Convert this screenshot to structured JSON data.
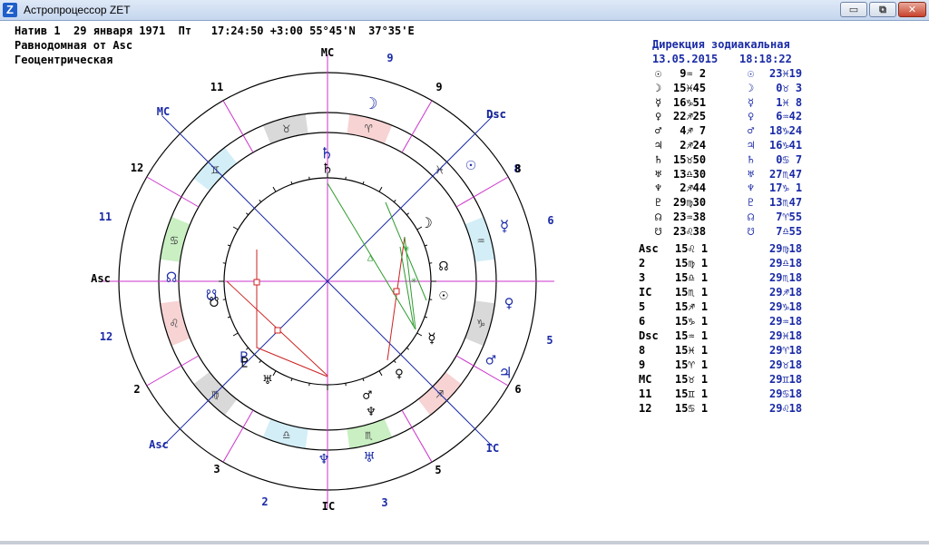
{
  "window": {
    "title": "Астропроцессор ZET",
    "app_icon": "Z",
    "minimize": "▭",
    "maximize": "⧉",
    "close": "✕"
  },
  "header": {
    "line1": "Натив 1  29 января 1971  Пт   17:24:50 +3:00 55°45'N  37°35'E",
    "line2": "Равнодомная от Asc",
    "line3": "Геоцентрическая"
  },
  "chart": {
    "outer_houses": [
      {
        "label": "MC",
        "color": "#000000"
      },
      {
        "label": "9",
        "color": "#1a2aa6"
      },
      {
        "label": "8",
        "color": "#1a2aa6"
      },
      {
        "label": "Dsc",
        "color": "#000000"
      },
      {
        "label": "6",
        "color": "#1a2aa6"
      },
      {
        "label": "5",
        "color": "#1a2aa6"
      },
      {
        "label": "IC",
        "color": "#000000"
      },
      {
        "label": "3",
        "color": "#1a2aa6"
      },
      {
        "label": "2",
        "color": "#1a2aa6"
      },
      {
        "label": "Asc",
        "color": "#000000"
      },
      {
        "label": "12",
        "color": "#1a2aa6"
      },
      {
        "label": "11",
        "color": "#1a2aa6"
      },
      {
        "label": "MC",
        "color": "#1a2aa6"
      },
      {
        "label": "Dsc",
        "color": "#1a2aa6"
      },
      {
        "label": "IC",
        "color": "#1a2aa6"
      },
      {
        "label": "Asc",
        "color": "#1a2aa6"
      },
      {
        "label": "9",
        "color": "#000000"
      },
      {
        "label": "8",
        "color": "#000000"
      },
      {
        "label": "6",
        "color": "#000000"
      },
      {
        "label": "5",
        "color": "#000000"
      },
      {
        "label": "3",
        "color": "#000000"
      },
      {
        "label": "2",
        "color": "#000000"
      },
      {
        "label": "12",
        "color": "#000000"
      },
      {
        "label": "11",
        "color": "#000000"
      }
    ],
    "zodiac": [
      {
        "sign": "♉",
        "fill": "#d9d9d9"
      },
      {
        "sign": "♈",
        "fill": "#f7d3d3"
      },
      {
        "sign": "♓",
        "fill": "#ffffff"
      },
      {
        "sign": "♒",
        "fill": "#d3eef7"
      },
      {
        "sign": "♑",
        "fill": "#d9d9d9"
      },
      {
        "sign": "♐",
        "fill": "#f7d3d3"
      },
      {
        "sign": "♏",
        "fill": "#c9efc2"
      },
      {
        "sign": "♎",
        "fill": "#d3eef7"
      },
      {
        "sign": "♍",
        "fill": "#d9d9d9"
      },
      {
        "sign": "♌",
        "fill": "#f7d3d3"
      },
      {
        "sign": "♋",
        "fill": "#c9efc2"
      },
      {
        "sign": "♊",
        "fill": "#d3eef7"
      }
    ],
    "outer_planets": [
      "☽",
      "☉",
      "☿",
      "♀",
      "♂",
      "♃",
      "♄",
      "♅",
      "♆",
      "♇",
      "☊",
      "☋"
    ],
    "inner_planets": [
      "♄",
      "☽",
      "☊",
      "☉",
      "☿",
      "♀",
      "♂",
      "♅",
      "♆",
      "♇",
      "☋"
    ]
  },
  "panel": {
    "title": "Дирекция зодиакальная",
    "date": "13.05.2015",
    "time": "18:18:22",
    "planets": [
      {
        "g1": "☉",
        "v1": " 9♒ 2",
        "g2": "☉",
        "v2": "23♓19"
      },
      {
        "g1": "☽",
        "v1": "15♓45",
        "g2": "☽",
        "v2": " 0♉ 3"
      },
      {
        "g1": "☿",
        "v1": "16♑51",
        "g2": "☿",
        "v2": " 1♓ 8"
      },
      {
        "g1": "♀",
        "v1": "22♐25",
        "g2": "♀",
        "v2": " 6♒42"
      },
      {
        "g1": "♂",
        "v1": " 4♐ 7",
        "g2": "♂",
        "v2": "18♑24"
      },
      {
        "g1": "♃",
        "v1": " 2♐24",
        "g2": "♃",
        "v2": "16♑41"
      },
      {
        "g1": "♄",
        "v1": "15♉50",
        "g2": "♄",
        "v2": " 0♋ 7"
      },
      {
        "g1": "♅",
        "v1": "13♎30",
        "g2": "♅",
        "v2": "27♏47"
      },
      {
        "g1": "♆",
        "v1": " 2♐44",
        "g2": "♆",
        "v2": "17♑ 1"
      },
      {
        "g1": "♇",
        "v1": "29♍30",
        "g2": "♇",
        "v2": "13♏47"
      },
      {
        "g1": "☊",
        "v1": "23♒38",
        "g2": "☊",
        "v2": " 7♈55"
      },
      {
        "g1": "☋",
        "v1": "23♌38",
        "g2": "☋",
        "v2": " 7♎55"
      }
    ],
    "houses": [
      {
        "h": "Asc",
        "v1": "15♌ 1",
        "v2": "29♍18"
      },
      {
        "h": "2",
        "v1": "15♍ 1",
        "v2": "29♎18"
      },
      {
        "h": "3",
        "v1": "15♎ 1",
        "v2": "29♏18"
      },
      {
        "h": "IC",
        "v1": "15♏ 1",
        "v2": "29♐18"
      },
      {
        "h": "5",
        "v1": "15♐ 1",
        "v2": "29♑18"
      },
      {
        "h": "6",
        "v1": "15♑ 1",
        "v2": "29♒18"
      },
      {
        "h": "Dsc",
        "v1": "15♒ 1",
        "v2": "29♓18"
      },
      {
        "h": "8",
        "v1": "15♓ 1",
        "v2": "29♈18"
      },
      {
        "h": "9",
        "v1": "15♈ 1",
        "v2": "29♉18"
      },
      {
        "h": "MC",
        "v1": "15♉ 1",
        "v2": "29♊18"
      },
      {
        "h": "11",
        "v1": "15♊ 1",
        "v2": "29♋18"
      },
      {
        "h": "12",
        "v1": "15♋ 1",
        "v2": "29♌18"
      }
    ]
  }
}
